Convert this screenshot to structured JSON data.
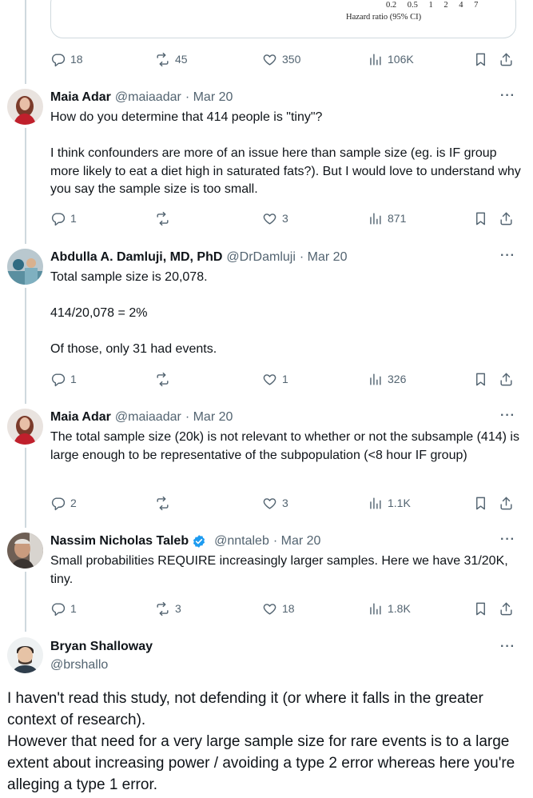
{
  "chart_card": {
    "ticks": [
      "0.2",
      "0.5",
      "1",
      "2",
      "4",
      "7"
    ],
    "xlabel": "Hazard ratio (95% CI)"
  },
  "top_tweet_stats": {
    "replies": "18",
    "retweets": "45",
    "likes": "350",
    "views": "106K"
  },
  "replies": [
    {
      "name": "Maia Adar",
      "handle": "@maiaadar",
      "date": "· Mar 20",
      "text": "How do you determine that 414 people is \"tiny\"?\n\nI think confounders are more of an issue here than sample size (eg. is IF group more likely to eat a diet high in saturated fats?). But I would love to understand why you say the sample size is too small.",
      "stats": {
        "replies": "1",
        "retweets": "",
        "likes": "3",
        "views": "871"
      }
    },
    {
      "name": "Abdulla A. Damluji, MD, PhD",
      "handle": "@DrDamluji",
      "date": "· Mar 20",
      "text": "Total sample size is 20,078.\n\n414/20,078 = 2%\n\nOf those, only 31 had events.",
      "stats": {
        "replies": "1",
        "retweets": "",
        "likes": "1",
        "views": "326"
      }
    },
    {
      "name": "Maia Adar",
      "handle": "@maiaadar",
      "date": "· Mar 20",
      "text": "The total sample size (20k) is not relevant to whether or not the subsample (414) is large enough to be representative of the subpopulation (<8 hour IF group)",
      "stats": {
        "replies": "2",
        "retweets": "",
        "likes": "3",
        "views": "1.1K"
      }
    },
    {
      "name": "Nassim Nicholas Taleb",
      "handle": "@nntaleb",
      "date": "· Mar 20",
      "text": "Small probabilities REQUIRE increasingly larger samples. Here we have 31/20K, tiny.",
      "stats": {
        "replies": "1",
        "retweets": "3",
        "likes": "18",
        "views": "1.8K"
      }
    }
  ],
  "main_tweet": {
    "name": "Bryan Shalloway",
    "handle": "@brshallo",
    "text": "I haven't read this study, not defending it (or where it falls in the greater context of research).\nHowever that need for a very large sample size for rare events is to a large extent about increasing power / avoiding a type 2 error whereas here you're alleging a type 1 error."
  },
  "more_label": "···",
  "colors": {
    "secondary_text": "#536471",
    "thread_line": "#cfd9de",
    "verified": "#1d9bf0"
  }
}
